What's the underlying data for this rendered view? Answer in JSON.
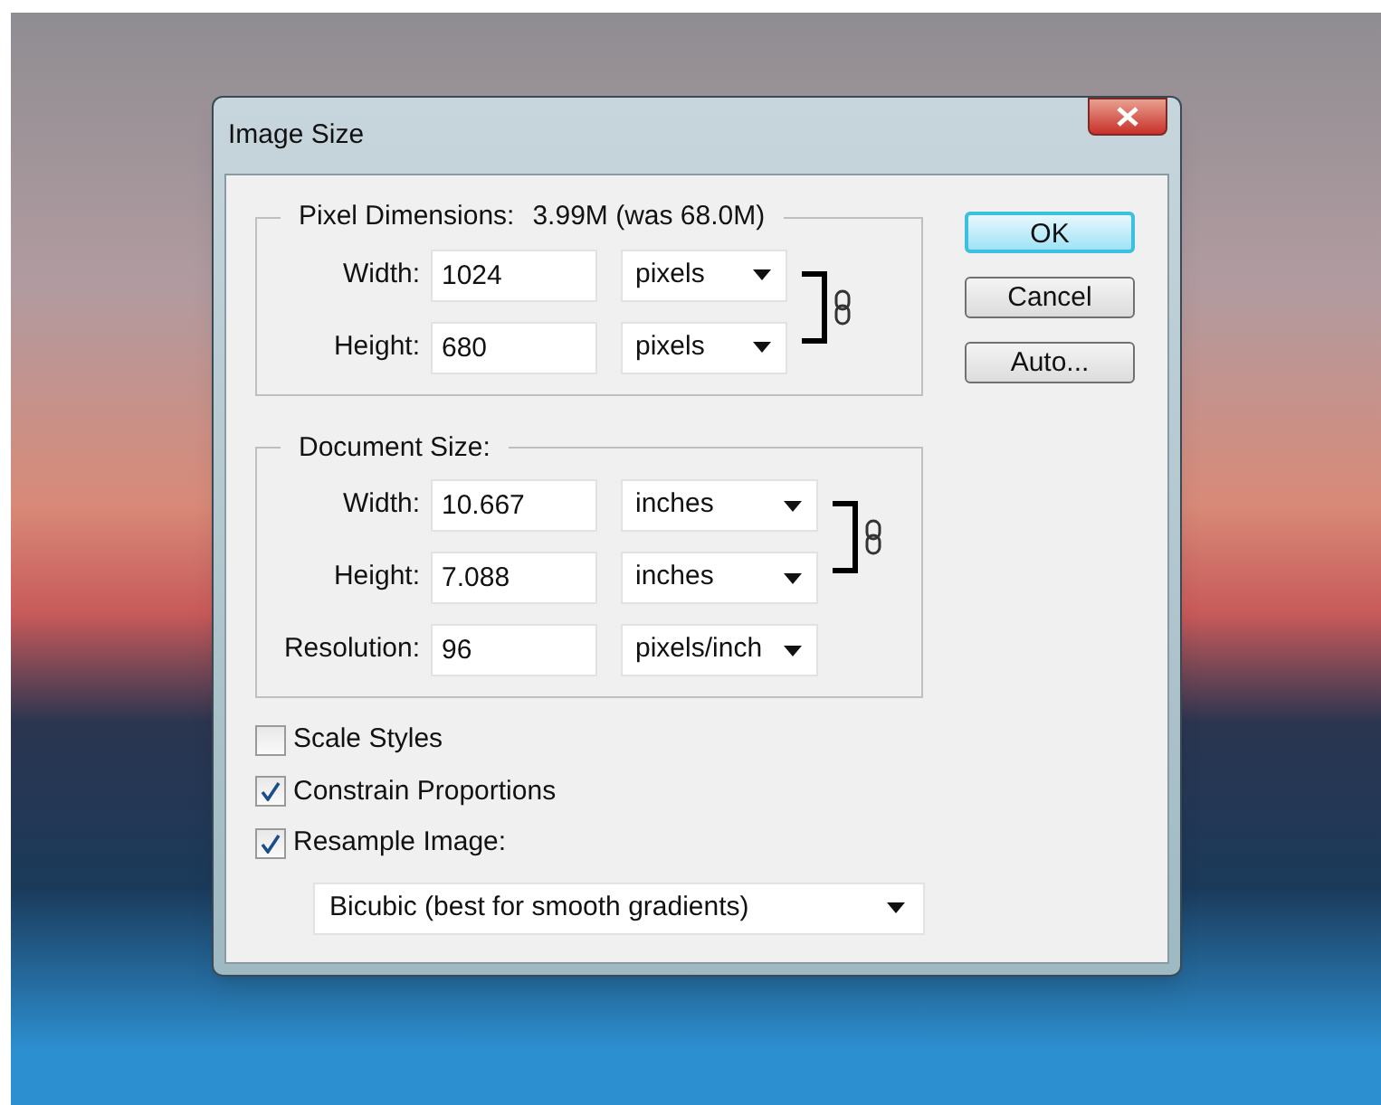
{
  "window": {
    "title": "Image Size"
  },
  "pixel_dimensions": {
    "legend": "Pixel Dimensions:",
    "reading": "3.99M (was 68.0M)",
    "linked": true,
    "fields": [
      {
        "label": "Width:",
        "value": "1024",
        "unit": "pixels"
      },
      {
        "label": "Height:",
        "value": "680",
        "unit": "pixels"
      }
    ]
  },
  "document_size": {
    "legend": "Document Size:",
    "linked": true,
    "fields": [
      {
        "label": "Width:",
        "value": "10.667",
        "unit": "inches"
      },
      {
        "label": "Height:",
        "value": "7.088",
        "unit": "inches"
      },
      {
        "label": "Resolution:",
        "value": "96",
        "unit": "pixels/inch"
      }
    ]
  },
  "options": [
    {
      "label": "Scale Styles",
      "checked": false
    },
    {
      "label": "Constrain Proportions",
      "checked": true
    },
    {
      "label": "Resample Image:",
      "checked": true
    }
  ],
  "resample_method": "Bicubic (best for smooth gradients)",
  "buttons": [
    {
      "label": "OK",
      "focused": true
    },
    {
      "label": "Cancel",
      "focused": false
    },
    {
      "label": "Auto...",
      "focused": false
    }
  ]
}
